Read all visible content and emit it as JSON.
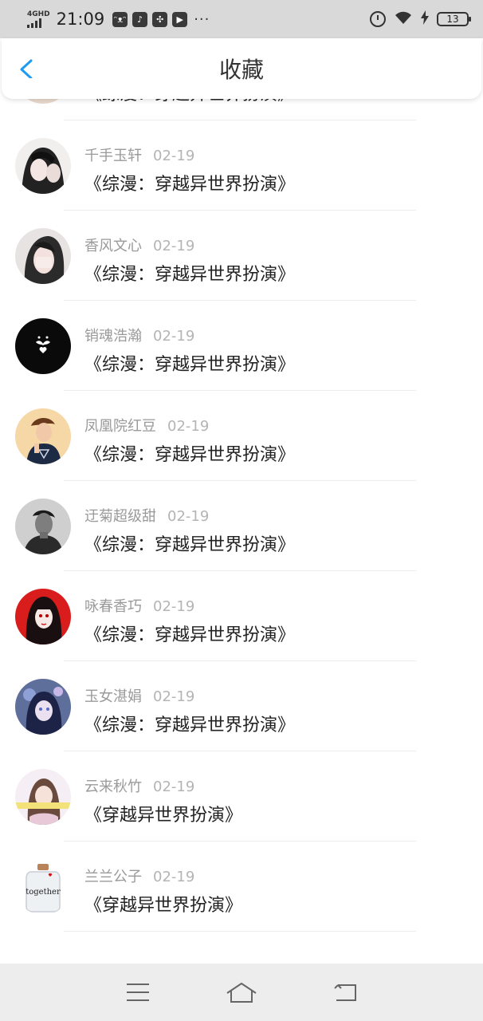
{
  "status_bar": {
    "network_type": "4GHD",
    "time": "21:09",
    "app_icons": [
      "cat-icon",
      "tiktok-icon",
      "pinwheel-icon",
      "video-icon"
    ],
    "more": "···",
    "battery": "13"
  },
  "header": {
    "title": "收藏",
    "accent_color": "#1e9bf0"
  },
  "items": [
    {
      "user": "",
      "date": "",
      "text": "《综漫：穿越异世界扮演》"
    },
    {
      "user": "千手玉轩",
      "date": "02-19",
      "text": "《综漫：穿越异世界扮演》"
    },
    {
      "user": "香风文心",
      "date": "02-19",
      "text": "《综漫：穿越异世界扮演》"
    },
    {
      "user": "销魂浩瀚",
      "date": "02-19",
      "text": "《综漫：穿越异世界扮演》"
    },
    {
      "user": "凤凰院红豆",
      "date": "02-19",
      "text": "《综漫：穿越异世界扮演》"
    },
    {
      "user": "迂菊超级甜",
      "date": "02-19",
      "text": "《综漫：穿越异世界扮演》"
    },
    {
      "user": "咏春香巧",
      "date": "02-19",
      "text": "《综漫：穿越异世界扮演》"
    },
    {
      "user": "玉女湛娟",
      "date": "02-19",
      "text": "《综漫：穿越异世界扮演》"
    },
    {
      "user": "云来秋竹",
      "date": "02-19",
      "text": "《穿越异世界扮演》"
    },
    {
      "user": "兰兰公子",
      "date": "02-19",
      "text": "《穿越异世界扮演》"
    }
  ],
  "avatar_text": {
    "mug": "together"
  },
  "navbar": {
    "icons": [
      "menu-icon",
      "home-icon",
      "back-nav-icon"
    ]
  }
}
